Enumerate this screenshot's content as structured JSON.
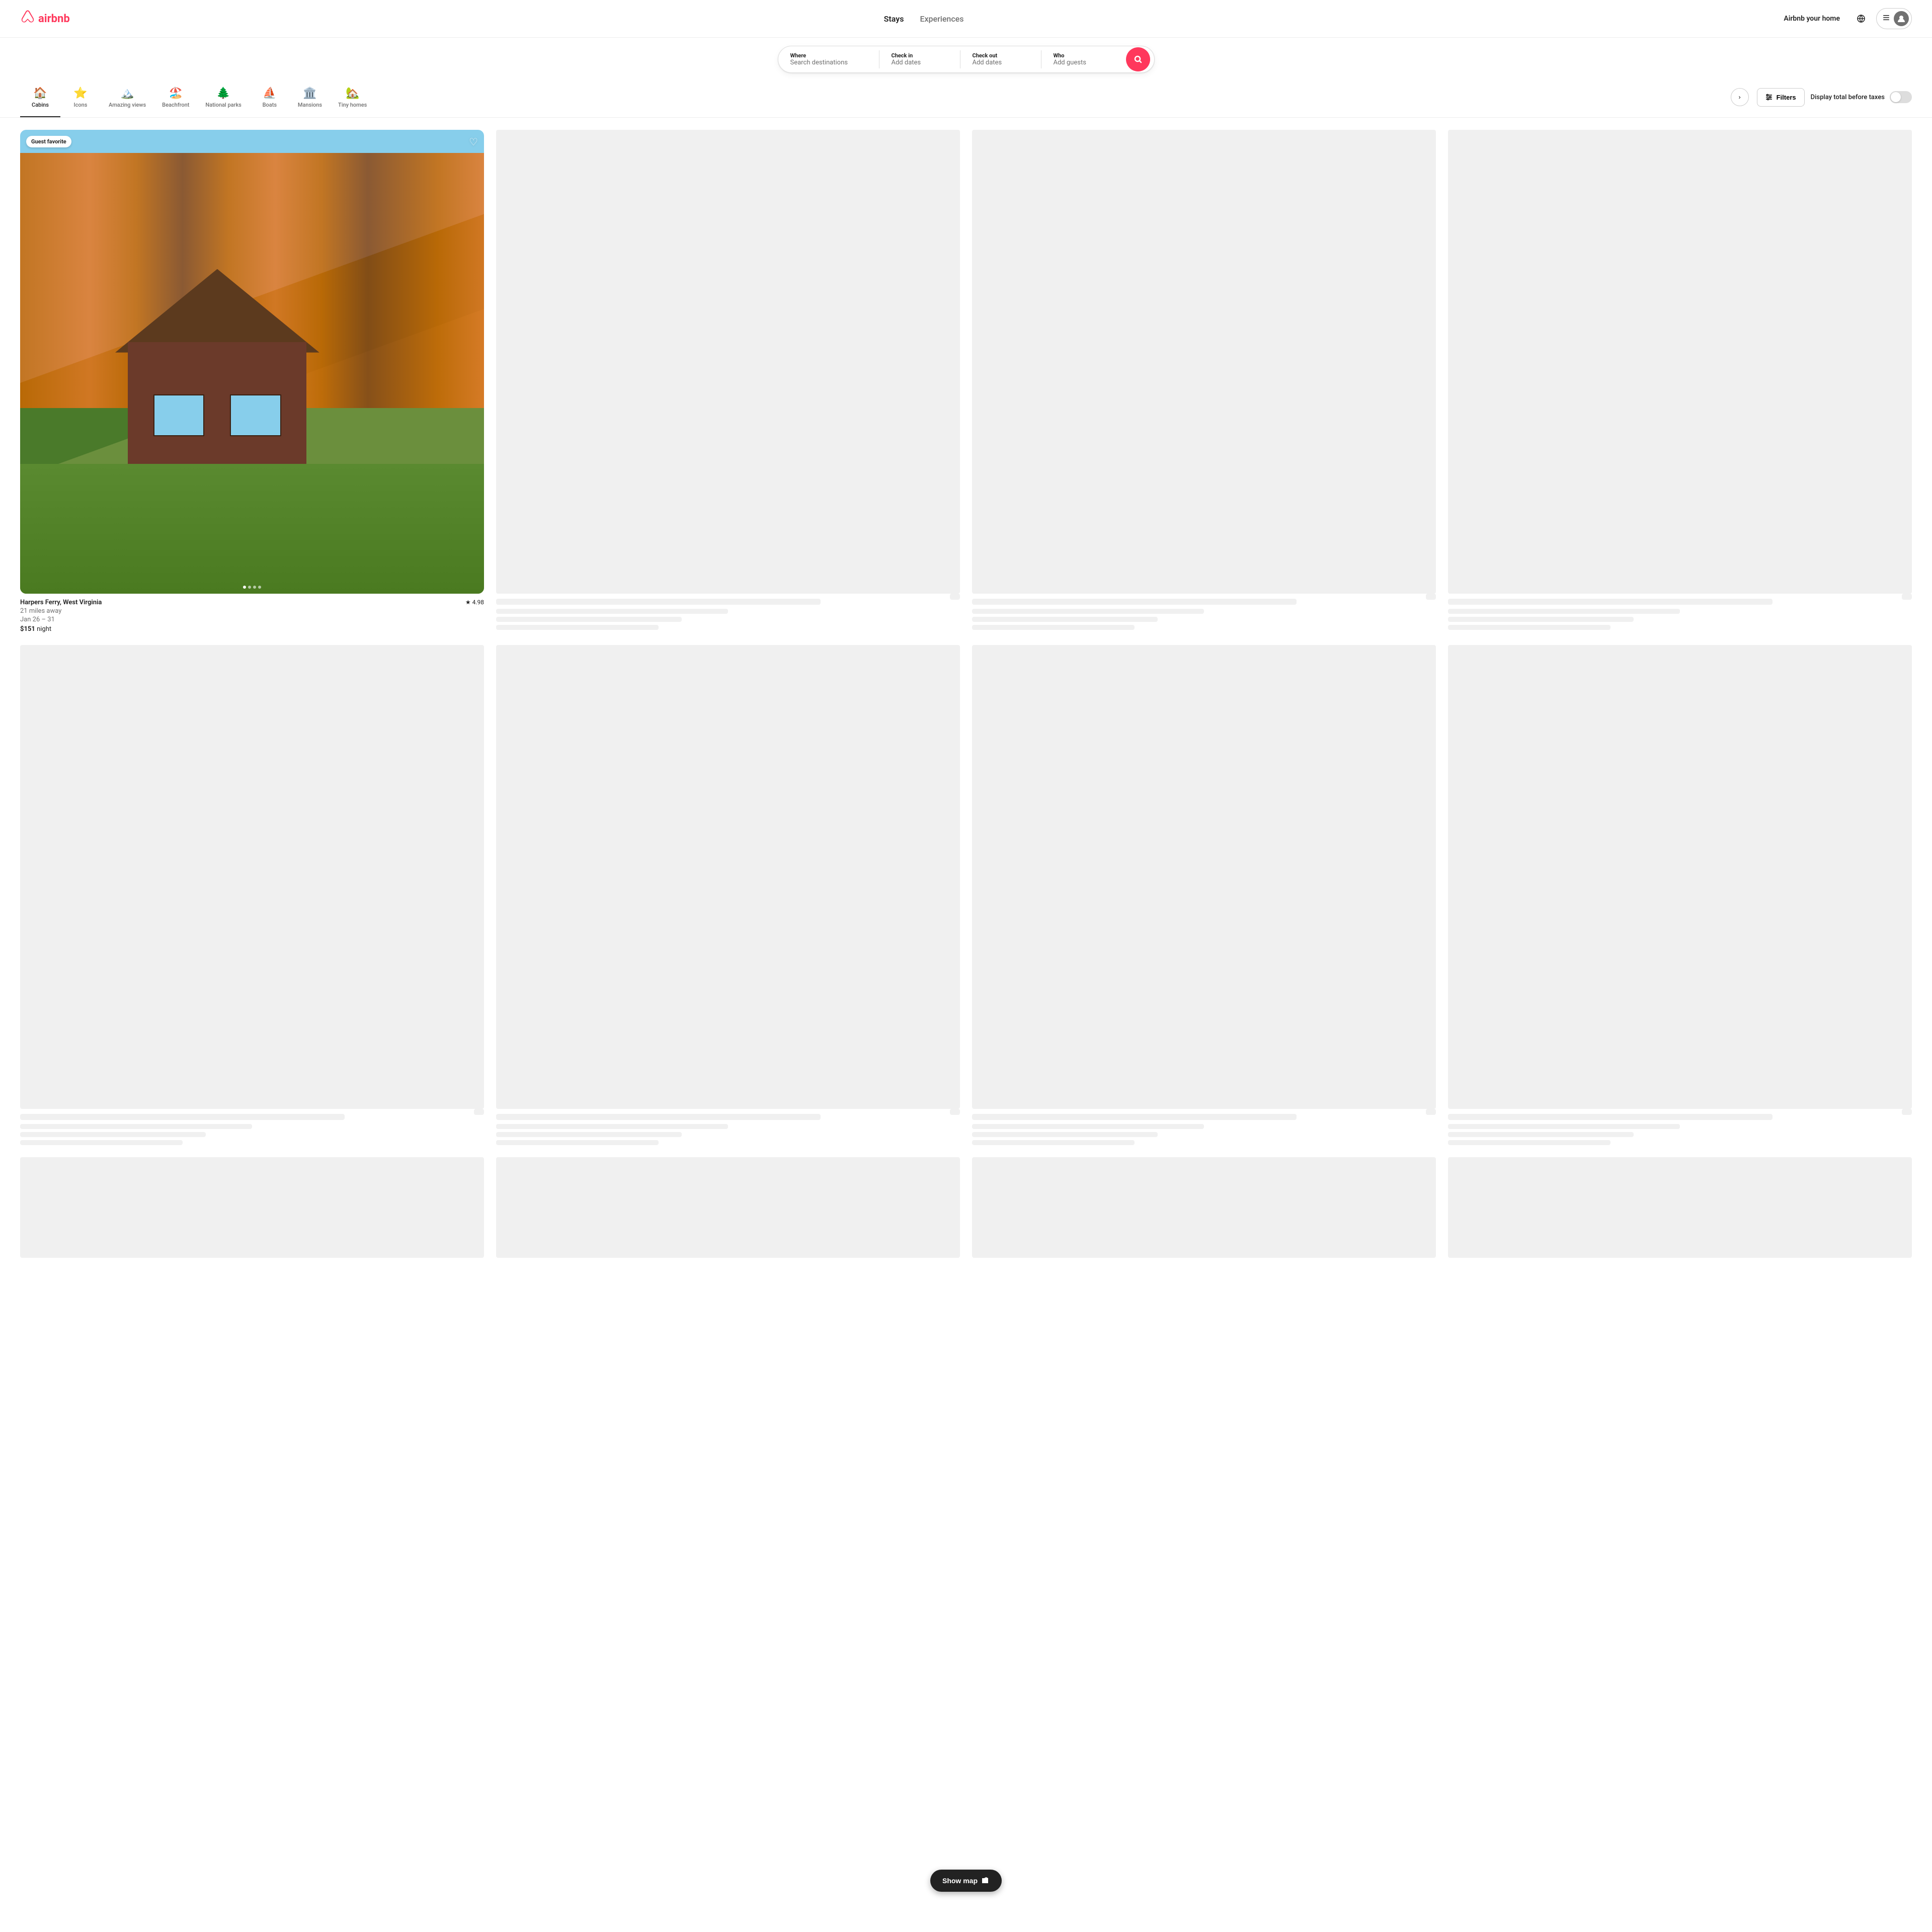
{
  "header": {
    "logo_text": "airbnb",
    "nav": {
      "stays": "Stays",
      "experiences": "Experiences"
    },
    "airbnb_home": "Airbnb your home",
    "user_menu_label": "Menu"
  },
  "search_bar": {
    "where_label": "Where",
    "where_placeholder": "Search destinations",
    "checkin_label": "Check in",
    "checkin_value": "Add dates",
    "checkout_label": "Check out",
    "checkout_value": "Add dates",
    "who_label": "Who",
    "who_value": "Add guests"
  },
  "categories": [
    {
      "id": "cabins",
      "label": "Cabins",
      "icon": "🏠",
      "active": true
    },
    {
      "id": "icons",
      "label": "Icons",
      "icon": "⭐",
      "active": false
    },
    {
      "id": "amazing-views",
      "label": "Amazing views",
      "icon": "🏔️",
      "active": false
    },
    {
      "id": "beachfront",
      "label": "Beachfront",
      "icon": "🏖️",
      "active": false
    },
    {
      "id": "national-parks",
      "label": "National parks",
      "icon": "🌲",
      "active": false
    },
    {
      "id": "boats",
      "label": "Boats",
      "icon": "⛵",
      "active": false
    },
    {
      "id": "mansions",
      "label": "Mansions",
      "icon": "🏛️",
      "active": false
    },
    {
      "id": "tiny-homes",
      "label": "Tiny homes",
      "icon": "🏡",
      "active": false
    }
  ],
  "filters_btn": "Filters",
  "taxes_toggle": {
    "label": "Display total before taxes",
    "enabled": false
  },
  "featured_listing": {
    "title": "Harpers Ferry, West Virginia",
    "distance": "21 miles away",
    "dates": "Jan 26 – 31",
    "price": "$151",
    "price_unit": "night",
    "rating": "4.98",
    "badge": "Guest favorite",
    "dots": [
      true,
      false,
      false,
      false
    ]
  },
  "show_map_btn": "Show map"
}
